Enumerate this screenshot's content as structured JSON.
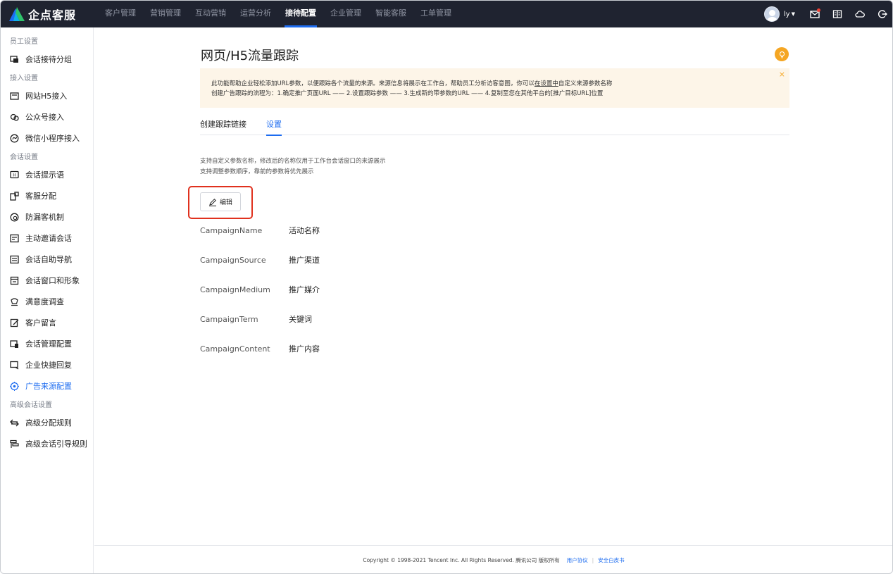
{
  "brand": {
    "name": "企点客服"
  },
  "nav": {
    "items": [
      "客户管理",
      "营销管理",
      "互动营销",
      "运营分析",
      "接待配置",
      "企业管理",
      "智能客服",
      "工单管理"
    ],
    "active_index": 4
  },
  "user": {
    "name": "ly"
  },
  "top_icons": [
    "mail-icon",
    "book-icon",
    "cloud-icon",
    "logout-icon"
  ],
  "sidebar": {
    "groups": [
      {
        "title": "员工设置",
        "items": [
          "会话接待分组"
        ]
      },
      {
        "title": "接入设置",
        "items": [
          "网站H5接入",
          "公众号接入",
          "微信小程序接入"
        ]
      },
      {
        "title": "会话设置",
        "items": [
          "会话提示语",
          "客服分配",
          "防漏客机制",
          "主动邀请会话",
          "会话自助导航",
          "会话窗口和形象",
          "满意度调查",
          "客户留言",
          "会话管理配置",
          "企业快捷回复",
          "广告来源配置"
        ]
      },
      {
        "title": "高级会话设置",
        "items": [
          "高级分配规则",
          "高级会话引导规则"
        ]
      }
    ],
    "active_item": "广告来源配置"
  },
  "page": {
    "title": "网页/H5流量跟踪",
    "notice": {
      "line1_before": "此功能帮助企业轻松添加URL参数，以便跟踪各个流量的来源。来源信息将展示在工作台，帮助员工分析访客意图，你可以",
      "line1_link": "在设置中",
      "line1_after": "自定义来源参数名称",
      "line2": "创建广告跟踪的流程为：1.确定推广页面URL —— 2.设置跟踪参数 —— 3.生成新的带参数的URL —— 4.复制至您在其他平台的[推广目标URL]位置",
      "close": "×"
    },
    "tabs": [
      "创建跟踪链接",
      "设置"
    ],
    "active_tab": 1,
    "help": {
      "line1": "支持自定义参数名称，修改后的名称仅用于工作台会话窗口的来源展示",
      "line2": "支持调整参数顺序，靠前的参数将优先展示"
    },
    "edit_label": "编辑",
    "params": [
      {
        "key": "CampaignName",
        "value": "活动名称"
      },
      {
        "key": "CampaignSource",
        "value": "推广渠道"
      },
      {
        "key": "CampaignMedium",
        "value": "推广媒介"
      },
      {
        "key": "CampaignTerm",
        "value": "关键词"
      },
      {
        "key": "CampaignContent",
        "value": "推广内容"
      }
    ]
  },
  "footer": {
    "copyright": "Copyright © 1998-2021 Tencent Inc. All Rights Reserved. 腾讯公司 版权所有",
    "links": [
      "用户协议",
      "安全白皮书"
    ],
    "separator": "|"
  },
  "colors": {
    "accent": "#1d6cf0",
    "topbar": "#1f2330",
    "notice_bg": "#fdf5e8",
    "warning": "#f5a623",
    "highlight": "#e0311e"
  }
}
